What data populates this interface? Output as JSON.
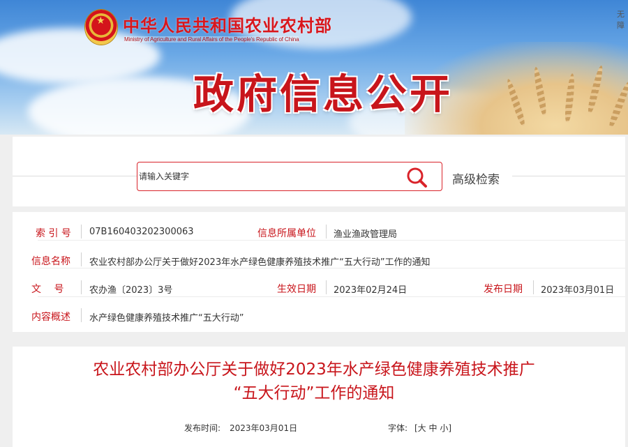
{
  "header": {
    "ministry_name_cn": "中华人民共和国农业农村部",
    "ministry_name_en": "Ministry of Agriculture and Rural Affairs of the People's Republic of China",
    "banner_title": "政府信息公开",
    "top_right_text": "无障"
  },
  "search": {
    "placeholder": "请输入关键字",
    "advanced_label": "高级检索"
  },
  "info": {
    "index_label": "索 引 号",
    "index_value": "07B160403202300063",
    "unit_label": "信息所属单位",
    "unit_value": "渔业渔政管理局",
    "name_label": "信息名称",
    "name_value": "农业农村部办公厅关于做好2023年水产绿色健康养殖技术推广“五大行动”工作的通知",
    "docno_label": "文　 号",
    "docno_value": "农办渔〔2023〕3号",
    "effective_label": "生效日期",
    "effective_value": "2023年02月24日",
    "publish_label": "发布日期",
    "publish_value": "2023年03月01日",
    "summary_label": "内容概述",
    "summary_value": "水产绿色健康养殖技术推广“五大行动”"
  },
  "article": {
    "title_line1": "农业农村部办公厅关于做好2023年水产绿色健康养殖技术推广",
    "title_line2": "“五大行动”工作的通知",
    "publish_time_label": "发布时间:",
    "publish_time_value": "2023年03月01日",
    "font_label": "字体:",
    "font_options": [
      "[大",
      "中",
      "小]"
    ]
  },
  "colors": {
    "accent_red": "#c8151b",
    "page_bg": "#efefef"
  }
}
